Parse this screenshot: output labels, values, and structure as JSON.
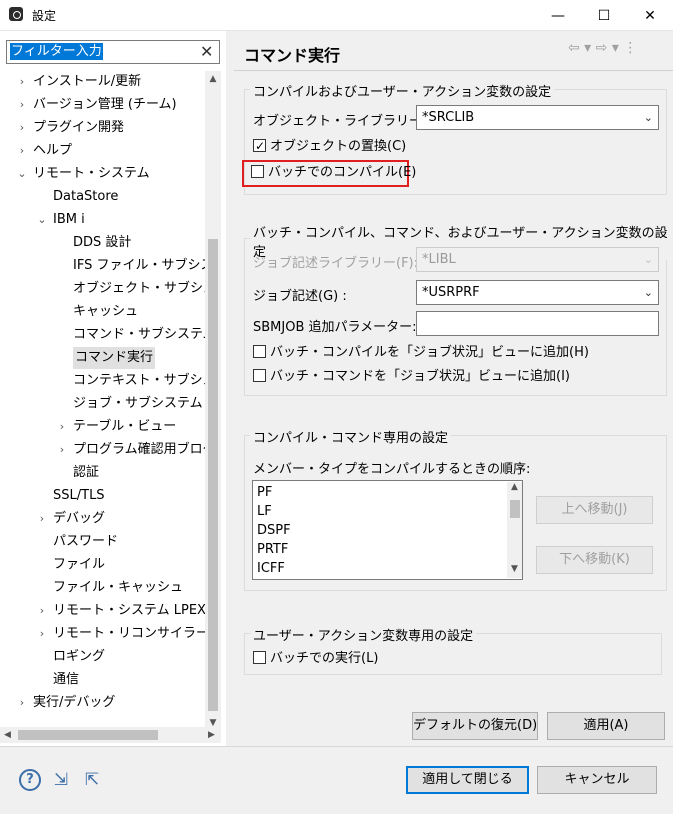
{
  "window": {
    "title": "設定",
    "min_glyph": "—",
    "max_glyph": "☐",
    "close_glyph": "✕"
  },
  "filter": {
    "value": "フィルター入力",
    "clear_glyph": "✕"
  },
  "tree": [
    {
      "label": "インストール/更新",
      "twisty": "›"
    },
    {
      "label": "バージョン管理 (チーム)",
      "twisty": "›"
    },
    {
      "label": "プラグイン開発",
      "twisty": "›"
    },
    {
      "label": "ヘルプ",
      "twisty": "›"
    },
    {
      "label": "リモート・システム",
      "twisty": "⌄"
    },
    {
      "label": "DataStore",
      "twisty": ""
    },
    {
      "label": "IBM i",
      "twisty": "⌄"
    },
    {
      "label": "DDS 設計",
      "twisty": ""
    },
    {
      "label": "IFS ファイル・サブシステ",
      "twisty": ""
    },
    {
      "label": "オブジェクト・サブシステ",
      "twisty": ""
    },
    {
      "label": "キャッシュ",
      "twisty": ""
    },
    {
      "label": "コマンド・サブシステム",
      "twisty": ""
    },
    {
      "label": "コマンド実行",
      "twisty": "",
      "selected": true
    },
    {
      "label": "コンテキスト・サブシステ",
      "twisty": ""
    },
    {
      "label": "ジョブ・サブシステム",
      "twisty": ""
    },
    {
      "label": "テーブル・ビュー",
      "twisty": "›"
    },
    {
      "label": "プログラム確認用ブログ",
      "twisty": "›"
    },
    {
      "label": "認証",
      "twisty": ""
    },
    {
      "label": "SSL/TLS",
      "twisty": ""
    },
    {
      "label": "デバッグ",
      "twisty": "›"
    },
    {
      "label": "パスワード",
      "twisty": ""
    },
    {
      "label": "ファイル",
      "twisty": ""
    },
    {
      "label": "ファイル・キャッシュ",
      "twisty": ""
    },
    {
      "label": "リモート・システム LPEX エ",
      "twisty": "›"
    },
    {
      "label": "リモート・リコンサイラー",
      "twisty": "›"
    },
    {
      "label": "ロギング",
      "twisty": ""
    },
    {
      "label": "通信",
      "twisty": ""
    },
    {
      "label": "実行/デバッグ",
      "twisty": "›"
    }
  ],
  "scroll_glyphs": {
    "up": "▲",
    "down": "▼",
    "left": "◀",
    "right": "▶"
  },
  "page": {
    "title": "コマンド実行",
    "nav": "⇦ ▾ ⇨ ▾ ⋮"
  },
  "group1": {
    "legend": "コンパイルおよびユーザー・アクション変数の設定",
    "object_library_label": "オブジェクト・ライブラリー(B):",
    "object_library_value": "*SRCLIB",
    "replace_object_label": "オブジェクトの置換(C)",
    "replace_object_checked": true,
    "batch_compile_label": "バッチでのコンパイル(E)",
    "batch_compile_checked": false
  },
  "group2": {
    "legend": "バッチ・コンパイル、コマンド、およびユーザー・アクション変数の設定",
    "jobd_library_label": "ジョブ記述ライブラリー(F):",
    "jobd_library_value": "*LIBL",
    "jobd_label": "ジョブ記述(G) :",
    "jobd_value": "*USRPRF",
    "sbmjob_label": "SBMJOB 追加パラメーター:",
    "sbmjob_value": "",
    "add_compile_label": "バッチ・コンパイルを「ジョブ状況」ビューに追加(H)",
    "add_command_label": "バッチ・コマンドを「ジョブ状況」ビューに追加(I)"
  },
  "group3": {
    "legend": "コンパイル・コマンド専用の設定",
    "order_label": "メンバー・タイプをコンパイルするときの順序:",
    "member_types": [
      "PF",
      "LF",
      "DSPF",
      "PRTF",
      "ICFF"
    ],
    "move_up": "上へ移動(J)",
    "move_down": "下へ移動(K)"
  },
  "group4": {
    "legend": "ユーザー・アクション変数専用の設定",
    "batch_run_label": "バッチでの実行(L)"
  },
  "buttons": {
    "restore_defaults": "デフォルトの復元(D)",
    "apply": "適用(A)",
    "apply_and_close": "適用して閉じる",
    "cancel": "キャンセル"
  },
  "footer_icons": {
    "help": "?",
    "import": "⇲",
    "export": "⇱"
  },
  "colors": {
    "selection": "#0078d7",
    "highlight_box": "#e02020",
    "default_button_border": "#0078d7"
  }
}
